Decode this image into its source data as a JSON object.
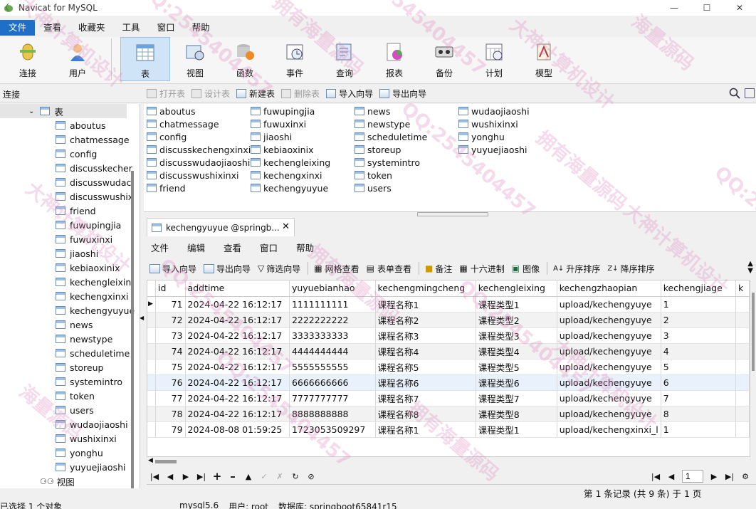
{
  "window": {
    "title": "Navicat for MySQL",
    "min": "—",
    "max": "☐",
    "close": "✕"
  },
  "menubar": [
    "文件",
    "查看",
    "收藏夹",
    "工具",
    "窗口",
    "帮助"
  ],
  "toolbar": [
    {
      "label": "连接",
      "icon": "connection-icon"
    },
    {
      "label": "用户",
      "icon": "user-icon"
    },
    {
      "label": "表",
      "icon": "table-icon",
      "active": true
    },
    {
      "label": "视图",
      "icon": "view-icon"
    },
    {
      "label": "函数",
      "icon": "function-icon"
    },
    {
      "label": "事件",
      "icon": "event-icon"
    },
    {
      "label": "查询",
      "icon": "query-icon"
    },
    {
      "label": "报表",
      "icon": "report-icon"
    },
    {
      "label": "备份",
      "icon": "backup-icon"
    },
    {
      "label": "计划",
      "icon": "schedule-icon"
    },
    {
      "label": "模型",
      "icon": "model-icon"
    }
  ],
  "connection_label": "连接",
  "object_tools": [
    {
      "label": "打开表",
      "disabled": true
    },
    {
      "label": "设计表",
      "disabled": true
    },
    {
      "label": "新建表",
      "disabled": false
    },
    {
      "label": "删除表",
      "disabled": true
    },
    {
      "label": "导入向导",
      "disabled": false
    },
    {
      "label": "导出向导",
      "disabled": false
    }
  ],
  "tree": {
    "tables_node": "表",
    "items": [
      "aboutus",
      "chatmessage",
      "config",
      "discusskecher",
      "discusswudac",
      "discusswushix",
      "friend",
      "fuwupingjia",
      "fuwuxinxi",
      "jiaoshi",
      "kebiaoxinix",
      "kechengleixin",
      "kechengxinxi",
      "kechengyuyue",
      "news",
      "newstype",
      "scheduletime",
      "storeup",
      "systemintro",
      "token",
      "users",
      "wudaojiaoshi",
      "wushixinxi",
      "yonghu",
      "yuyuejiaoshi"
    ],
    "views_node": "视图"
  },
  "objects": {
    "col1": [
      "aboutus",
      "chatmessage",
      "config",
      "discusskechengxinxi",
      "discusswudaojiaoshi",
      "discusswushixinxi",
      "friend"
    ],
    "col2": [
      "fuwupingjia",
      "fuwuxinxi",
      "jiaoshi",
      "kebiaoxinix",
      "kechengleixing",
      "kechengxinxi",
      "kechengyuyue"
    ],
    "col3": [
      "news",
      "newstype",
      "scheduletime",
      "storeup",
      "systemintro",
      "token",
      "users"
    ],
    "col4": [
      "wudaojiaoshi",
      "wushixinxi",
      "yonghu",
      "yuyuejiaoshi"
    ]
  },
  "tab": {
    "label": "kechengyuyue @springb...",
    "close": "✕"
  },
  "inner_menu": [
    "文件",
    "编辑",
    "查看",
    "窗口",
    "帮助"
  ],
  "inner_tools": [
    "导入向导",
    "导出向导",
    "筛选向导",
    "网格查看",
    "表单查看",
    "备注",
    "十六进制",
    "图像",
    "升序排序",
    "降序排序"
  ],
  "grid": {
    "columns": [
      "id",
      "addtime",
      "yuyuebianhao",
      "kechengmingcheng",
      "kechengleixing",
      "kechengzhaopian",
      "kechengjiage",
      "k"
    ],
    "rows": [
      [
        "71",
        "2024-04-22 16:12:17",
        "1111111111",
        "课程名称1",
        "课程类型1",
        "upload/kechengyuye",
        "1"
      ],
      [
        "72",
        "2024-04-22 16:12:17",
        "2222222222",
        "课程名称2",
        "课程类型2",
        "upload/kechengyuye",
        "2"
      ],
      [
        "73",
        "2024-04-22 16:12:17",
        "3333333333",
        "课程名称3",
        "课程类型3",
        "upload/kechengyuye",
        "3"
      ],
      [
        "74",
        "2024-04-22 16:12:17",
        "4444444444",
        "课程名称4",
        "课程类型4",
        "upload/kechengyuye",
        "4"
      ],
      [
        "75",
        "2024-04-22 16:12:17",
        "5555555555",
        "课程名称5",
        "课程类型5",
        "upload/kechengyuye",
        "5"
      ],
      [
        "76",
        "2024-04-22 16:12:17",
        "6666666666",
        "课程名称6",
        "课程类型6",
        "upload/kechengyuye",
        "6"
      ],
      [
        "77",
        "2024-04-22 16:12:17",
        "7777777777",
        "课程名称7",
        "课程类型7",
        "upload/kechengyuye",
        "7"
      ],
      [
        "78",
        "2024-04-22 16:12:17",
        "8888888888",
        "课程名称8",
        "课程类型8",
        "upload/kechengyuye",
        "8"
      ],
      [
        "79",
        "2024-08-08 01:59:25",
        "1723053509297",
        "课程名称1",
        "课程类型1",
        "upload/kechengxinxi_l",
        "1"
      ]
    ]
  },
  "pager": {
    "page": "1"
  },
  "record_status": "第 1 条记录 (共 9 条) 于 1 页",
  "statusbar": {
    "selection": "已选择 1 个对象",
    "server": "mysql5.6",
    "user": "用户: root",
    "database": "数据库: springboot65841r15"
  },
  "watermarks": [
    "大神计算机设计",
    "QQ:2545404457",
    "拥有海量源码",
    "QQ:2545404457",
    "大神计算机设计",
    "海量源码",
    "QQ:2545404457",
    "拥有海量源码"
  ]
}
